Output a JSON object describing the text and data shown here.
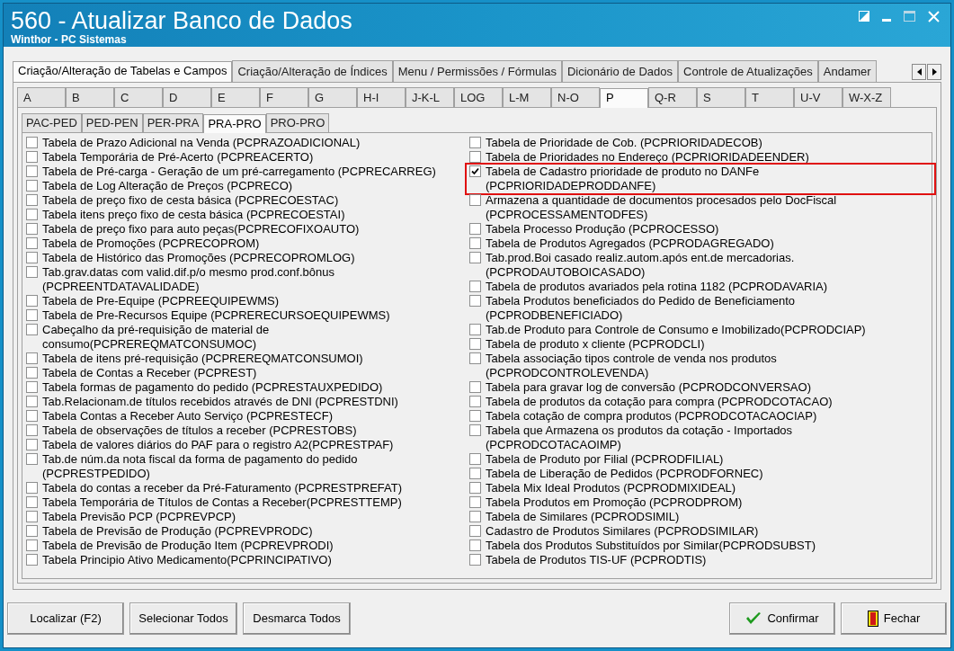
{
  "window": {
    "title": "560 - Atualizar Banco de Dados",
    "subtitle": "Winthor - PC Sistemas"
  },
  "main_tabs": [
    {
      "label": "Criação/Alteração de Tabelas e Campos",
      "selected": true
    },
    {
      "label": "Criação/Alteração de Índices",
      "selected": false
    },
    {
      "label": "Menu / Permissões / Fórmulas",
      "selected": false
    },
    {
      "label": "Dicionário de Dados",
      "selected": false
    },
    {
      "label": "Controle de Atualizações",
      "selected": false
    },
    {
      "label": "Andamer",
      "selected": false
    }
  ],
  "letter_tabs": [
    {
      "label": "A",
      "selected": false
    },
    {
      "label": "B",
      "selected": false
    },
    {
      "label": "C",
      "selected": false
    },
    {
      "label": "D",
      "selected": false
    },
    {
      "label": "E",
      "selected": false
    },
    {
      "label": "F",
      "selected": false
    },
    {
      "label": "G",
      "selected": false
    },
    {
      "label": "H-I",
      "selected": false
    },
    {
      "label": "J-K-L",
      "selected": false
    },
    {
      "label": "LOG",
      "selected": false
    },
    {
      "label": "L-M",
      "selected": false
    },
    {
      "label": "N-O",
      "selected": false
    },
    {
      "label": "P",
      "selected": true
    },
    {
      "label": "Q-R",
      "selected": false
    },
    {
      "label": "S",
      "selected": false
    },
    {
      "label": "T",
      "selected": false
    },
    {
      "label": "U-V",
      "selected": false
    },
    {
      "label": "W-X-Z",
      "selected": false
    }
  ],
  "sub_tabs": [
    {
      "label": "PAC-PED",
      "selected": false
    },
    {
      "label": "PED-PEN",
      "selected": false
    },
    {
      "label": "PER-PRA",
      "selected": false
    },
    {
      "label": "PRA-PRO",
      "selected": true
    },
    {
      "label": "PRO-PRO",
      "selected": false
    }
  ],
  "left_items": [
    {
      "label": "Tabela de Prazo Adicional na Venda (PCPRAZOADICIONAL)",
      "checked": false,
      "highlighted": false
    },
    {
      "label": "Tabela Temporária de Pré-Acerto (PCPREACERTO)",
      "checked": false,
      "highlighted": false
    },
    {
      "label": "Tabela de Pré-carga - Geração de um pré-carregamento  (PCPRECARREG)",
      "checked": false,
      "highlighted": false
    },
    {
      "label": "Tabela de Log Alteração de Preços (PCPRECO)",
      "checked": false,
      "highlighted": false
    },
    {
      "label": "Tabela de preço fixo de cesta básica (PCPRECOESTAC)",
      "checked": false,
      "highlighted": false
    },
    {
      "label": "Tabela itens preço fixo de cesta básica (PCPRECOESTAI)",
      "checked": false,
      "highlighted": false
    },
    {
      "label": "Tabela de preço fixo para auto peças(PCPRECOFIXOAUTO)",
      "checked": false,
      "highlighted": false
    },
    {
      "label": "Tabela de Promoções  (PCPRECOPROM)",
      "checked": false,
      "highlighted": false
    },
    {
      "label": "Tabela de Histórico das Promoções (PCPRECOPROMLOG)",
      "checked": false,
      "highlighted": false
    },
    {
      "label": "Tab.grav.datas com valid.dif.p/o mesmo prod.conf.bônus\n(PCPREENTDATAVALIDADE)",
      "checked": false,
      "highlighted": false
    },
    {
      "label": "Tabela de Pre-Equipe (PCPREEQUIPEWMS)",
      "checked": false,
      "highlighted": false
    },
    {
      "label": "Tabela de Pre-Recursos Equipe (PCPRERECURSOEQUIPEWMS)",
      "checked": false,
      "highlighted": false
    },
    {
      "label": "Cabeçalho da pré-requisição de material de\nconsumo(PCPREREQMATCONSUMOC)",
      "checked": false,
      "highlighted": false
    },
    {
      "label": "Tabela de itens pré-requisição (PCPREREQMATCONSUMOI)",
      "checked": false,
      "highlighted": false
    },
    {
      "label": "Tabela de Contas a Receber  (PCPREST)",
      "checked": false,
      "highlighted": false
    },
    {
      "label": "Tabela formas de pagamento do pedido (PCPRESTAUXPEDIDO)",
      "checked": false,
      "highlighted": false
    },
    {
      "label": "Tab.Relacionam.de títulos recebidos através de DNI (PCPRESTDNI)",
      "checked": false,
      "highlighted": false
    },
    {
      "label": "Tabela Contas a Receber Auto Serviço (PCPRESTECF)",
      "checked": false,
      "highlighted": false
    },
    {
      "label": "Tabela de observações de títulos a receber (PCPRESTOBS)",
      "checked": false,
      "highlighted": false
    },
    {
      "label": "Tabela de valores diários do PAF para o registro A2(PCPRESTPAF)",
      "checked": false,
      "highlighted": false
    },
    {
      "label": "Tab.de núm.da nota fiscal da forma de pagamento do pedido\n(PCPRESTPEDIDO)",
      "checked": false,
      "highlighted": false
    },
    {
      "label": "Tabela do contas a receber da Pré-Faturamento (PCPRESTPREFAT)",
      "checked": false,
      "highlighted": false
    },
    {
      "label": "Tabela Temporária de Títulos de Contas a Receber(PCPRESTTEMP)",
      "checked": false,
      "highlighted": false
    },
    {
      "label": "Tabela Previsão PCP (PCPREVPCP)",
      "checked": false,
      "highlighted": false
    },
    {
      "label": "Tabela de Previsão de Produção (PCPREVPRODC)",
      "checked": false,
      "highlighted": false
    },
    {
      "label": "Tabela de Previsão de Produção Item (PCPREVPRODI)",
      "checked": false,
      "highlighted": false
    },
    {
      "label": "Tabela Principio Ativo Medicamento(PCPRINCIPATIVO)",
      "checked": false,
      "highlighted": false
    }
  ],
  "right_items": [
    {
      "label": "Tabela de Prioridade de Cob. (PCPRIORIDADECOB)",
      "checked": false,
      "highlighted": false
    },
    {
      "label": "Tabela de Prioridades no Endereço (PCPRIORIDADEENDER)",
      "checked": false,
      "highlighted": false
    },
    {
      "label": "Tabela de Cadastro prioridade de produto no DANFe\n(PCPRIORIDADEPRODDANFE)",
      "checked": true,
      "highlighted": true
    },
    {
      "label": "Armazena a quantidade de documentos procesados pelo DocFiscal\n(PCPROCESSAMENTODFES)",
      "checked": false,
      "highlighted": false
    },
    {
      "label": "Tabela Processo Produção (PCPROCESSO)",
      "checked": false,
      "highlighted": false
    },
    {
      "label": "Tabela de Produtos Agregados (PCPRODAGREGADO)",
      "checked": false,
      "highlighted": false
    },
    {
      "label": "Tab.prod.Boi casado realiz.autom.após ent.de mercadorias.\n(PCPRODAUTOBOICASADO)",
      "checked": false,
      "highlighted": false
    },
    {
      "label": "Tabela de produtos avariados pela rotina 1182 (PCPRODAVARIA)",
      "checked": false,
      "highlighted": false
    },
    {
      "label": "Tabela Produtos beneficiados do Pedido de Beneficiamento\n(PCPRODBENEFICIADO)",
      "checked": false,
      "highlighted": false
    },
    {
      "label": "Tab.de Produto para Controle de Consumo e Imobilizado(PCPRODCIAP)",
      "checked": false,
      "highlighted": false
    },
    {
      "label": "Tabela de produto x cliente (PCPRODCLI)",
      "checked": false,
      "highlighted": false
    },
    {
      "label": "Tabela associação tipos controle de venda nos produtos\n(PCPRODCONTROLEVENDA)",
      "checked": false,
      "highlighted": false
    },
    {
      "label": "Tabela para gravar log de conversão (PCPRODCONVERSAO)",
      "checked": false,
      "highlighted": false
    },
    {
      "label": "Tabela de produtos da cotação para compra (PCPRODCOTACAO)",
      "checked": false,
      "highlighted": false
    },
    {
      "label": "Tabela cotação de compra produtos (PCPRODCOTACAOCIAP)",
      "checked": false,
      "highlighted": false
    },
    {
      "label": "Tabela que Armazena os produtos da cotação - Importados\n(PCPRODCOTACAOIMP)",
      "checked": false,
      "highlighted": false
    },
    {
      "label": "Tabela de Produto por Filial (PCPRODFILIAL)",
      "checked": false,
      "highlighted": false
    },
    {
      "label": "Tabela de Liberação de Pedidos (PCPRODFORNEC)",
      "checked": false,
      "highlighted": false
    },
    {
      "label": "Tabela Mix Ideal Produtos (PCPRODMIXIDEAL)",
      "checked": false,
      "highlighted": false
    },
    {
      "label": "Tabela Produtos em Promoção (PCPRODPROM)",
      "checked": false,
      "highlighted": false
    },
    {
      "label": "Tabela de Similares (PCPRODSIMIL)",
      "checked": false,
      "highlighted": false
    },
    {
      "label": "Cadastro de Produtos Similares (PCPRODSIMILAR)",
      "checked": false,
      "highlighted": false
    },
    {
      "label": "Tabela dos Produtos Substituídos por Similar(PCPRODSUBST)",
      "checked": false,
      "highlighted": false
    },
    {
      "label": "Tabela de Produtos TIS-UF (PCPRODTIS)",
      "checked": false,
      "highlighted": false
    }
  ],
  "left_buttons": [
    {
      "label": "Localizar (F2)"
    },
    {
      "label": "Selecionar Todos"
    },
    {
      "label": "Desmarca Todos"
    }
  ],
  "right_buttons": [
    {
      "label": "Confirmar",
      "kind": "confirm"
    },
    {
      "label": "Fechar",
      "kind": "close"
    }
  ]
}
